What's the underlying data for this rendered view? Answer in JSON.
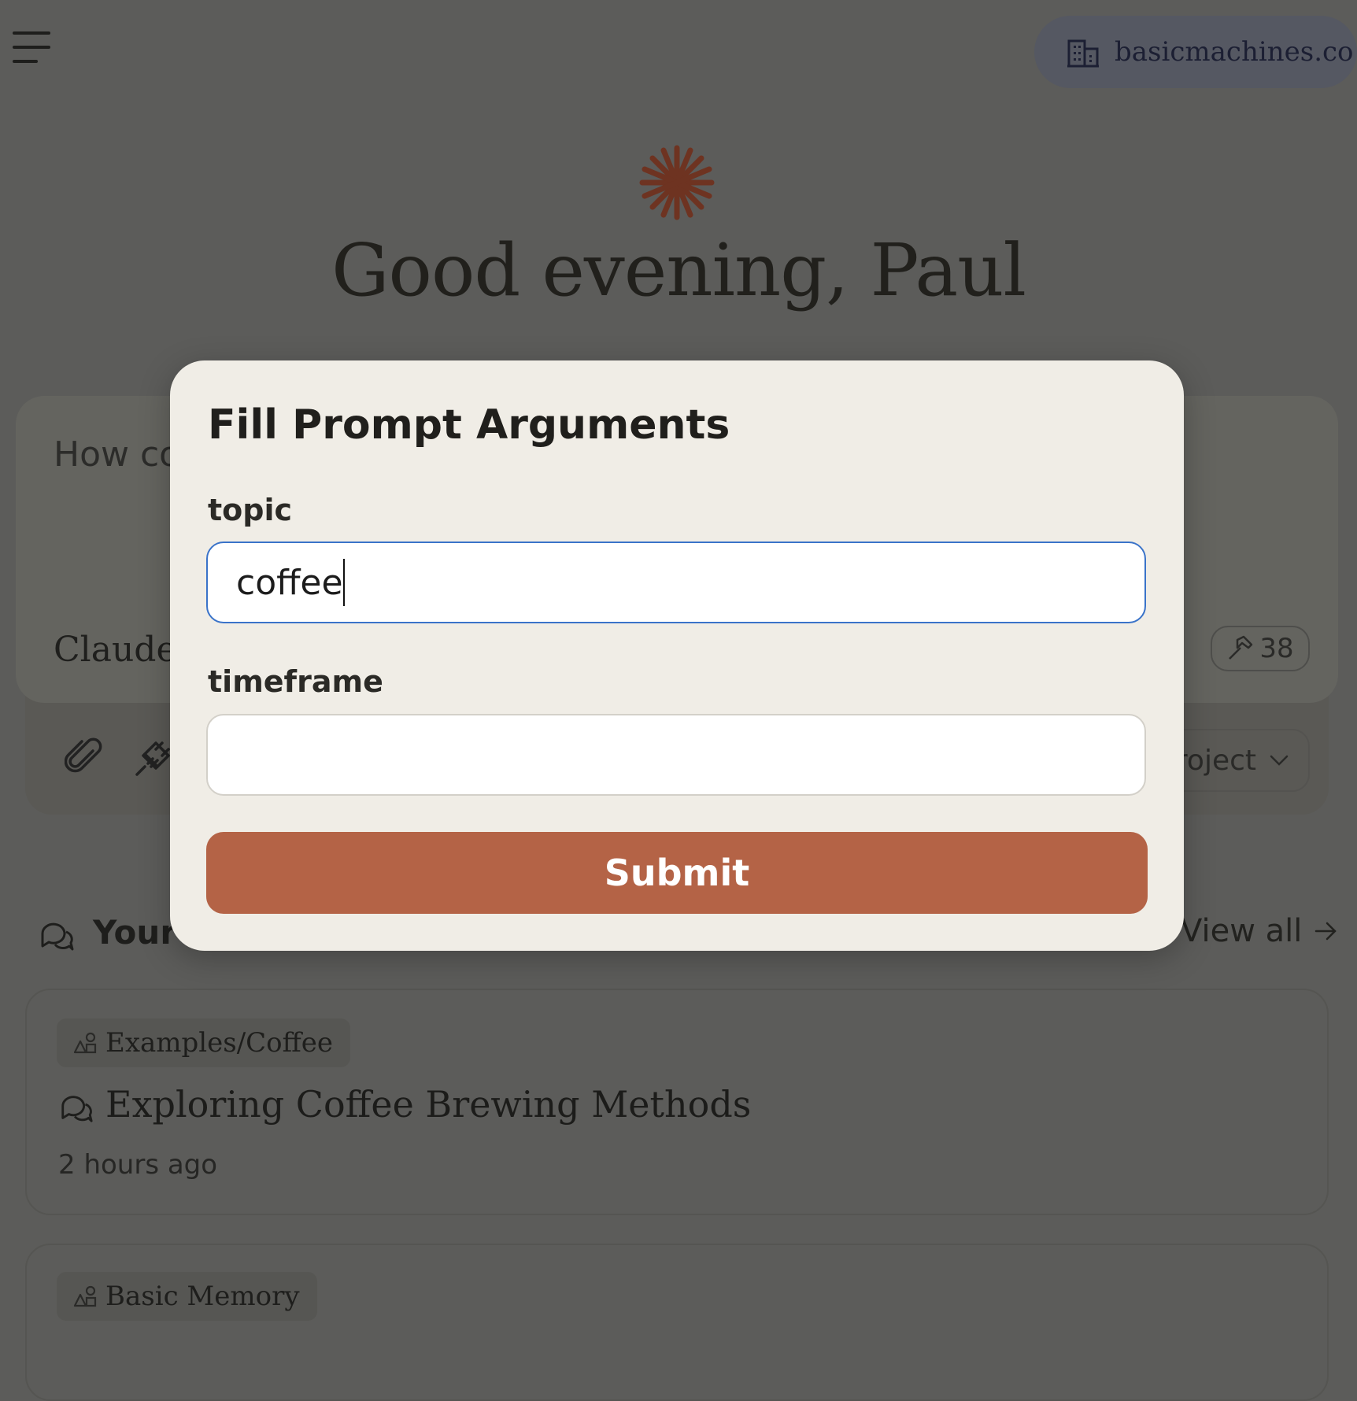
{
  "header": {
    "menu_icon": "hamburger-menu-icon",
    "org_icon": "building-icon",
    "org_name": "basicmachines.co"
  },
  "greeting": {
    "logo_icon": "claude-starburst-icon",
    "text": "Good evening, Paul"
  },
  "composer": {
    "placeholder_visible": "How co",
    "model_label_visible": "Claude",
    "tools_icon": "hammer-icon",
    "tools_count": "38",
    "attach_icon": "paperclip-icon",
    "integrations_icon": "plug-icon",
    "project_selector_visible": "roject",
    "project_chevron_icon": "chevron-down-icon"
  },
  "recents": {
    "icon": "chat-bubbles-icon",
    "title_visible": "Your r",
    "view_all": "View all",
    "view_all_icon": "arrow-right-icon",
    "items": [
      {
        "project": "Examples/Coffee",
        "project_icon": "project-shapes-icon",
        "title": "Exploring Coffee Brewing Methods",
        "title_icon": "chat-bubbles-icon",
        "time": "2 hours ago"
      },
      {
        "project": "Basic Memory",
        "project_icon": "project-shapes-icon"
      }
    ]
  },
  "modal": {
    "title": "Fill Prompt Arguments",
    "fields": [
      {
        "label": "topic",
        "value": "coffee",
        "placeholder": ""
      },
      {
        "label": "timeframe",
        "value": "",
        "placeholder": ""
      }
    ],
    "submit_label": "Submit"
  },
  "colors": {
    "overlay_bg": "#5c5c5a",
    "modal_bg": "#f0ede6",
    "submit_bg": "#b46346",
    "focus_border": "#3a73c9",
    "logo": "#b4552f"
  }
}
